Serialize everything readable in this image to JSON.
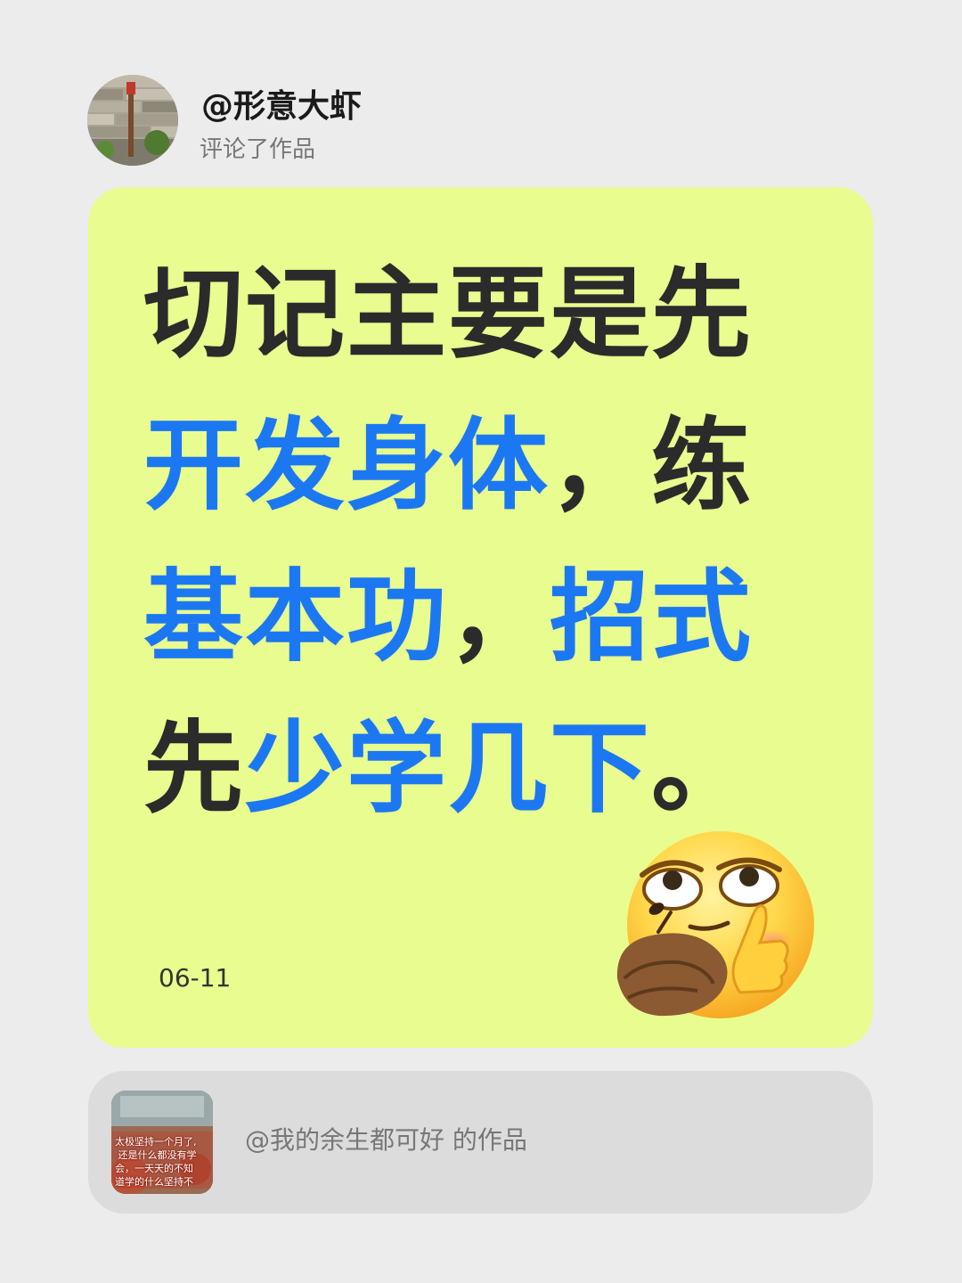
{
  "header": {
    "username": "@形意大虾",
    "action": "评论了作品"
  },
  "comment": {
    "lines": [
      [
        {
          "text": "切记主要是先",
          "highlight": false
        }
      ],
      [
        {
          "text": "开发身体",
          "highlight": true
        },
        {
          "text": "，练",
          "highlight": false
        }
      ],
      [
        {
          "text": "基本功",
          "highlight": true
        },
        {
          "text": "，",
          "highlight": false
        },
        {
          "text": "招式",
          "highlight": true
        }
      ],
      [
        {
          "text": "先",
          "highlight": false
        },
        {
          "text": "少学几下",
          "highlight": true
        },
        {
          "text": "。",
          "highlight": false
        }
      ]
    ],
    "date": "06-11",
    "emoji": "smirking-thinking-emoji"
  },
  "work": {
    "title": "@我的余生都可好 的作品",
    "thumbnail_caption": "太极坚持一个月了,\n 还是什么都没有学\n会，一天天的不知\n道学的什么坚持不"
  },
  "colors": {
    "background": "#ececec",
    "card": "#e8fc8f",
    "highlight": "#1c78f2",
    "text": "#2b2b2b",
    "work_card": "#dcdcdc"
  }
}
